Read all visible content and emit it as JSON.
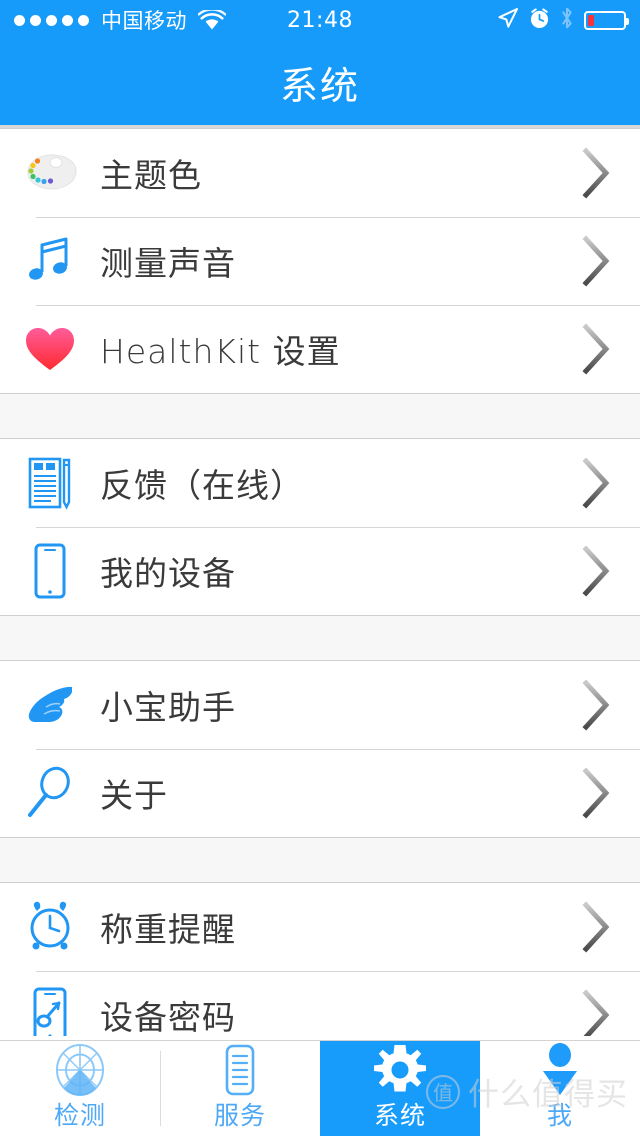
{
  "status_bar": {
    "signal_dots": 5,
    "carrier": "中国移动",
    "wifi_icon": "wifi-icon",
    "time": "21:48",
    "location_icon": "location-arrow-icon",
    "alarm_icon": "alarm-clock-icon",
    "bluetooth_icon": "bluetooth-icon",
    "battery_icon": "battery-low-icon",
    "battery_percent": 18,
    "battery_color": "#F5333F",
    "background_color": "#169BFA"
  },
  "nav_bar": {
    "title": "系统",
    "background_color": "#169BFA",
    "title_color": "#FFFFFF"
  },
  "accent_color": "#189CFC",
  "list": {
    "groups": [
      {
        "rows": [
          {
            "label": "主题色",
            "icon": "palette-icon",
            "chevron": "chevron-right-icon"
          },
          {
            "label": "测量声音",
            "icon": "music-note-icon",
            "chevron": "chevron-right-icon"
          },
          {
            "label": "HealthKit 设置",
            "icon": "heart-icon",
            "chevron": "chevron-right-icon"
          }
        ]
      },
      {
        "rows": [
          {
            "label": "反馈（在线）",
            "icon": "notepad-pencil-icon",
            "chevron": "chevron-right-icon"
          },
          {
            "label": "我的设备",
            "icon": "phone-device-icon",
            "chevron": "chevron-right-icon"
          }
        ]
      },
      {
        "rows": [
          {
            "label": "小宝助手",
            "icon": "pointing-hand-icon",
            "chevron": "chevron-right-icon"
          },
          {
            "label": "关于",
            "icon": "magnifier-icon",
            "chevron": "chevron-right-icon"
          }
        ]
      },
      {
        "rows": [
          {
            "label": "称重提醒",
            "icon": "alarm-clock-icon",
            "chevron": "chevron-right-icon"
          },
          {
            "label": "设备密码",
            "icon": "phone-key-icon",
            "chevron": "chevron-right-icon"
          }
        ]
      }
    ]
  },
  "tab_bar": {
    "tabs": [
      {
        "label": "检测",
        "icon": "radar-icon",
        "active": false
      },
      {
        "label": "服务",
        "icon": "document-list-icon",
        "active": false
      },
      {
        "label": "系统",
        "icon": "gear-icon",
        "active": true
      },
      {
        "label": "我",
        "icon": "person-icon",
        "active": false
      }
    ]
  },
  "watermark": {
    "badge": "值",
    "text": "什么值得买"
  }
}
